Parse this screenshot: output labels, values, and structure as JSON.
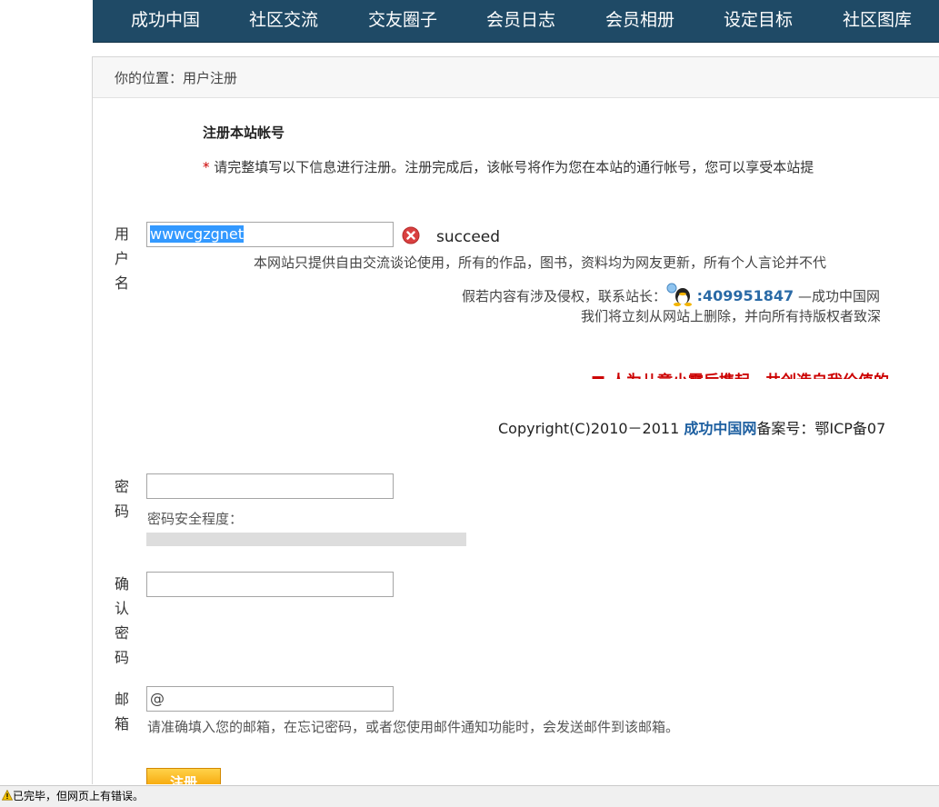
{
  "nav": {
    "items": [
      "成功中国",
      "社区交流",
      "交友圈子",
      "会员日志",
      "会员相册",
      "设定目标",
      "社区图库"
    ]
  },
  "breadcrumb": {
    "text": "你的位置：用户注册"
  },
  "form": {
    "heading": "注册本站帐号",
    "note_star": "*",
    "note_text": " 请完整填写以下信息进行注册。注册完成后，该帐号将作为您在本站的通行帐号，您可以享受本站提",
    "username": {
      "label": "用户名",
      "value": "wwwcgzgnet",
      "status": "succeed",
      "status_icon": "error-x-icon"
    },
    "password": {
      "label": "密码",
      "strength_label": "密码安全程度：",
      "strength": 0
    },
    "confirm": {
      "label": "确认密码"
    },
    "email": {
      "label": "邮箱",
      "value": "@",
      "hint": "请准确填入您的邮箱，在忘记密码，或者您使用邮件通知功能时，会发送邮件到该邮箱。"
    },
    "submit_label": "注册"
  },
  "overlay": {
    "line1": "本网站只提供自由交流谈论使用，所有的作品，图书，资料均为网友更新，所有个人言论并不代",
    "line2_prefix": "假若内容有涉及侵权，联系站长：",
    "qq_number": ":409951847",
    "line2_suffix": " —成功中国网",
    "line3": "我们将立刻从网站上删除，并向所有持版权者致深",
    "red_banner": "■ 人为儿童小霸后携起，共创造自我价值的",
    "copyright_prefix": "Copyright(C)2010－2011 ",
    "copyright_brand": "成功中国网",
    "copyright_suffix": "备案号：鄂ICP备07"
  },
  "statusbar": {
    "text": "已完毕，但网页上有错误。",
    "icon": "warning-icon"
  },
  "colors": {
    "nav_bg": "#1f4a66",
    "accent_red": "#cc0000",
    "link_blue": "#2a6aa6",
    "button_orange": "#f5a100"
  }
}
